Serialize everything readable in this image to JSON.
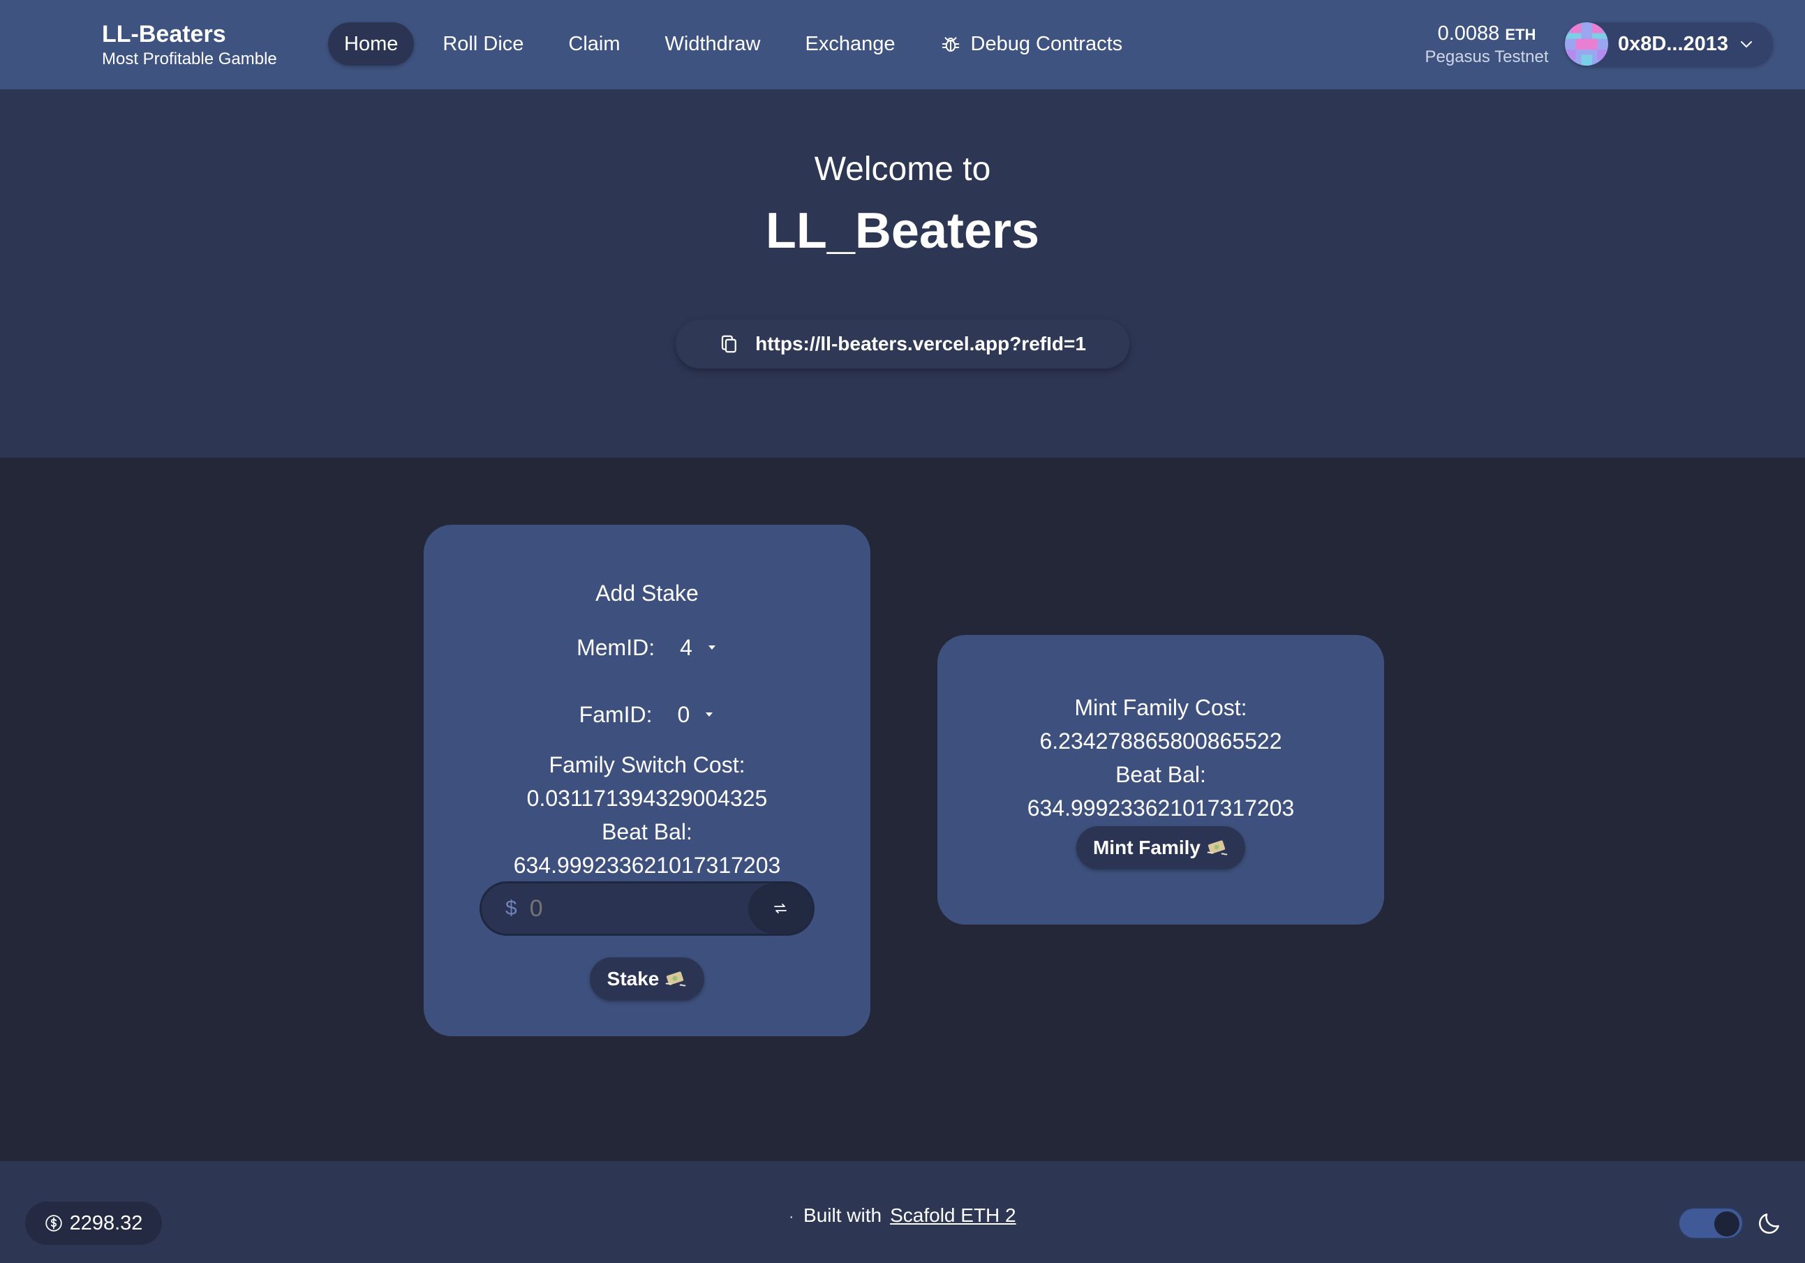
{
  "header": {
    "brand_title": "LL-Beaters",
    "brand_subtitle": "Most Profitable Gamble",
    "nav": [
      {
        "label": "Home",
        "active": true
      },
      {
        "label": "Roll Dice"
      },
      {
        "label": "Claim"
      },
      {
        "label": "Widthdraw"
      },
      {
        "label": "Exchange"
      },
      {
        "label": "Debug Contracts",
        "icon": "bug-icon"
      }
    ],
    "balance_value": "0.0088",
    "balance_unit": "ETH",
    "network": "Pegasus Testnet",
    "account": "0x8D...2013"
  },
  "hero": {
    "welcome": "Welcome to",
    "app_name": "LL_Beaters",
    "ref_link": "https://ll-beaters.vercel.app?refId=1"
  },
  "stake_card": {
    "title": "Add Stake",
    "mem_label": "MemID:",
    "mem_value": "4",
    "fam_label": "FamID:",
    "fam_value": "0",
    "switch_cost_label": "Family Switch Cost:",
    "switch_cost_value": "0.031171394329004325",
    "beat_bal_label": "Beat Bal:",
    "beat_bal_value": "634.999233621017317203",
    "amount_prefix": "$",
    "amount_placeholder": "0",
    "stake_label": "Stake"
  },
  "mint_card": {
    "cost_label": "Mint Family Cost:",
    "cost_value": "6.234278865800865522",
    "beat_bal_label": "Beat Bal:",
    "beat_bal_value": "634.999233621017317203",
    "mint_label": "Mint Family"
  },
  "footer": {
    "price": "2298.32",
    "dot": "·",
    "built_with": "Built with",
    "built_link": "Scafold ETH 2",
    "dark_mode": true
  },
  "colors": {
    "header_bg": "#3f5380",
    "hero_bg": "#2d3653",
    "body_bg": "#232738",
    "card_bg": "#3e517e",
    "button_bg": "#2b3553"
  }
}
